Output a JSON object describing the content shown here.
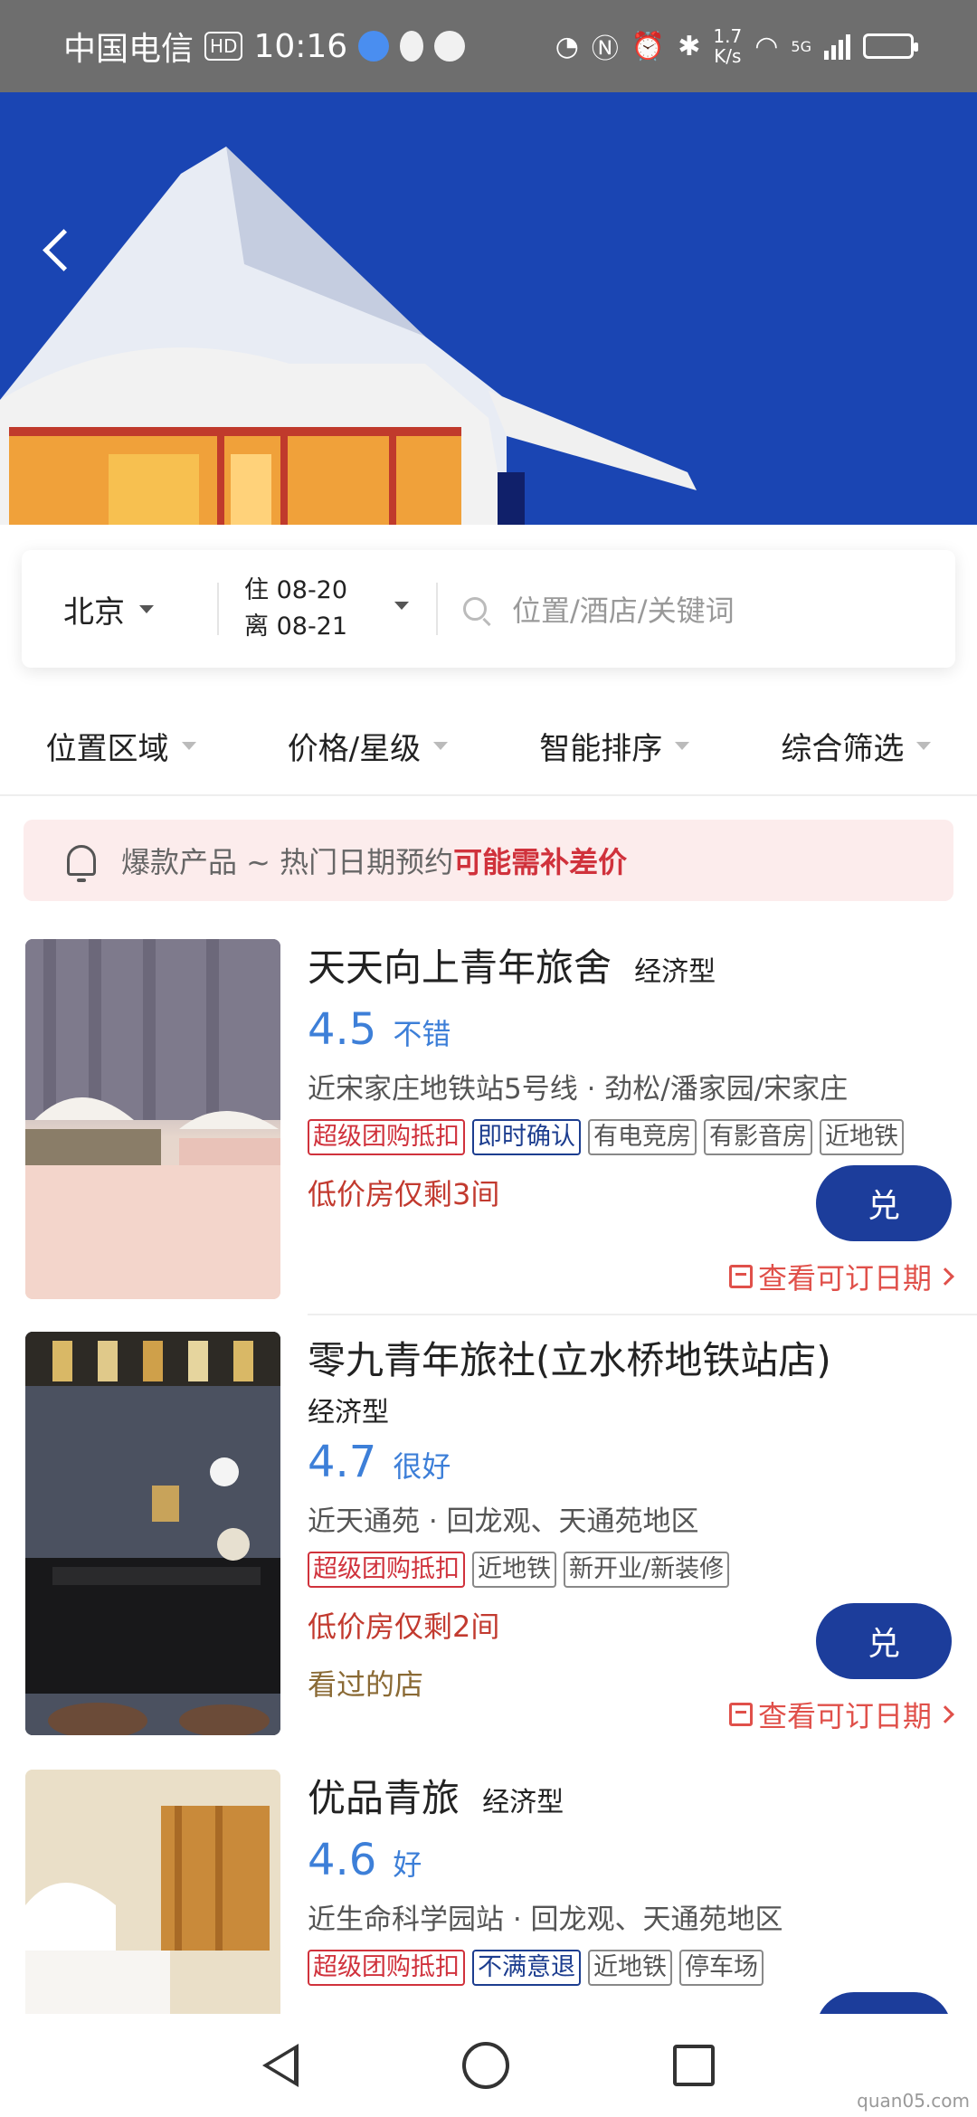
{
  "status_bar": {
    "carrier": "中国电信",
    "hd": "HD",
    "time": "10:16",
    "speed_value": "1.7",
    "speed_unit": "K/s",
    "network": "5G"
  },
  "search": {
    "city": "北京",
    "checkin": "住 08-20",
    "checkout": "离 08-21",
    "placeholder": "位置/酒店/关键词"
  },
  "filters": [
    "位置区域",
    "价格/星级",
    "智能排序",
    "综合筛选"
  ],
  "notice": {
    "text": "爆款产品 ~ 热门日期预约",
    "highlight": "可能需补差价"
  },
  "hotels": [
    {
      "name": "天天向上青年旅舍",
      "type": "经济型",
      "score": "4.5",
      "score_word": "不错",
      "location": "近宋家庄地铁站5号线 · 劲松/潘家园/宋家庄",
      "tags": [
        "超级团购抵扣",
        "即时确认",
        "有电竞房",
        "有影音房",
        "近地铁"
      ],
      "low_stock": "低价房仅剩3间",
      "redeem_label": "兑",
      "availability": "查看可订日期"
    },
    {
      "name": "零九青年旅社(立水桥地铁站店)",
      "type": "经济型",
      "score": "4.7",
      "score_word": "很好",
      "location": "近天通苑 · 回龙观、天通苑地区",
      "tags": [
        "超级团购抵扣",
        "近地铁",
        "新开业/新装修"
      ],
      "low_stock": "低价房仅剩2间",
      "seen": "看过的店",
      "redeem_label": "兑",
      "availability": "查看可订日期"
    },
    {
      "name": "优品青旅",
      "type": "经济型",
      "score": "4.6",
      "score_word": "好",
      "location": "近生命科学园站 · 回龙观、天通苑地区",
      "tags": [
        "超级团购抵扣",
        "不满意退",
        "近地铁",
        "停车场"
      ]
    }
  ],
  "watermark": "quan05.com",
  "colors": {
    "accent_blue": "#1c3d9b",
    "rating_blue": "#3d7fd8",
    "alert_red": "#d0323c"
  }
}
